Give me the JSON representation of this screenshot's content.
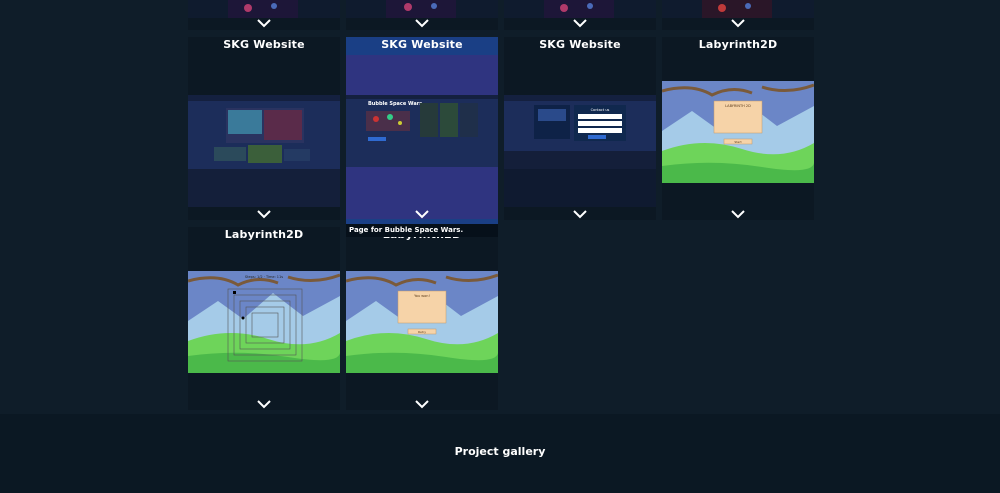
{
  "gallery": {
    "cards": [
      {
        "title": "SKG Website",
        "thumb": "skg-home"
      },
      {
        "title": "SKG Website",
        "thumb": "skg-bubble"
      },
      {
        "title": "SKG Website",
        "thumb": "skg-contact"
      },
      {
        "title": "Labyrinth2D",
        "thumb": "laby-dialog"
      },
      {
        "title": "Labyrinth2D",
        "thumb": "laby-maze"
      },
      {
        "title": "Labyrinth2D",
        "thumb": "laby-win"
      }
    ],
    "tooltip": "Page for Bubble Space Wars.",
    "thumb_texts": {
      "bubble_heading": "Bubble Space Wars",
      "contact_heading": "Contact us",
      "dialog_heading": "LABYRINTH 2D",
      "dialog_button": "Start",
      "maze_hud": "Steps: 1/2 · Time: 11s",
      "win_heading": "You won!",
      "win_button": "Retry"
    }
  },
  "footer": {
    "title": "Project gallery"
  },
  "colors": {
    "highlight": "#1a3f85",
    "card_bg": "#0c1823",
    "page_bg": "#0f1d29"
  }
}
